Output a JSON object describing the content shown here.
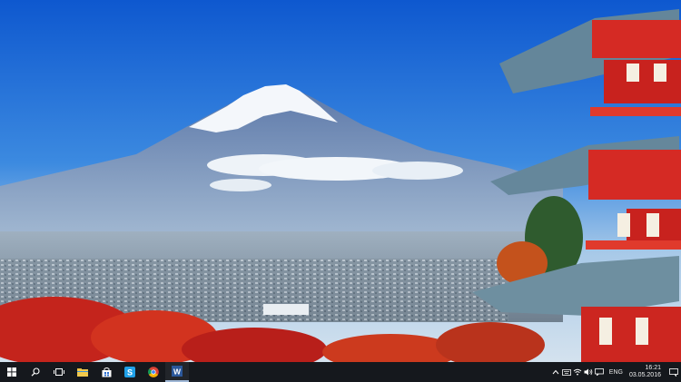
{
  "desktop": {
    "wallpaper": "mount-fuji-pagoda-wallpaper",
    "sky_color": "#1d67d6",
    "pagoda_color": "#d52a24"
  },
  "taskbar": {
    "start_icon": "windows-logo-icon",
    "search_icon": "search-icon",
    "task_view_icon": "task-view-icon",
    "apps": [
      {
        "name": "File Explorer",
        "icon": "file-explorer-icon"
      },
      {
        "name": "Store",
        "icon": "store-icon"
      },
      {
        "name": "Skype",
        "icon": "skype-icon",
        "label": "S"
      },
      {
        "name": "Google Chrome",
        "icon": "chrome-icon"
      },
      {
        "name": "Microsoft Word",
        "icon": "word-icon",
        "label": "W"
      }
    ],
    "tray": {
      "language": "ENG",
      "time": "16:21",
      "date": "03.05.2016"
    }
  }
}
